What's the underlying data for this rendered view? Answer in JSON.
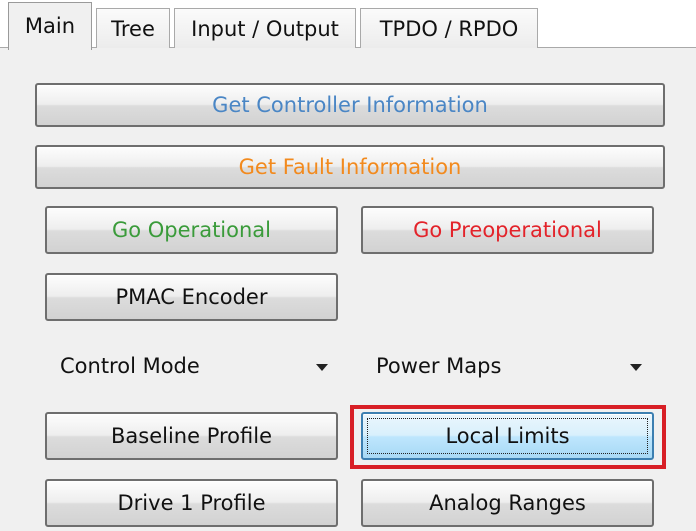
{
  "tabs": [
    {
      "label": "Main",
      "active": true
    },
    {
      "label": "Tree"
    },
    {
      "label": "Input / Output"
    },
    {
      "label": "TPDO / RPDO"
    }
  ],
  "buttons": {
    "get_controller_info": {
      "label": "Get Controller Information",
      "color": "#4a86c5"
    },
    "get_fault_info": {
      "label": "Get Fault Information",
      "color": "#f28a1e"
    },
    "go_operational": {
      "label": "Go Operational",
      "color": "#3a9b3a"
    },
    "go_preoperational": {
      "label": "Go Preoperational",
      "color": "#e3232a"
    },
    "pmac_encoder": {
      "label": "PMAC Encoder"
    },
    "baseline_profile": {
      "label": "Baseline Profile"
    },
    "local_limits": {
      "label": "Local Limits"
    },
    "drive1_profile": {
      "label": "Drive 1 Profile"
    },
    "analog_ranges": {
      "label": "Analog Ranges"
    }
  },
  "dropdowns": {
    "control_mode": {
      "selected": "Control Mode",
      "icon": "chevron-down-icon"
    },
    "power_maps": {
      "selected": "Power Maps",
      "icon": "chevron-down-icon"
    }
  },
  "highlight": {
    "target": "local-limits-button",
    "color": "#d81f26"
  }
}
